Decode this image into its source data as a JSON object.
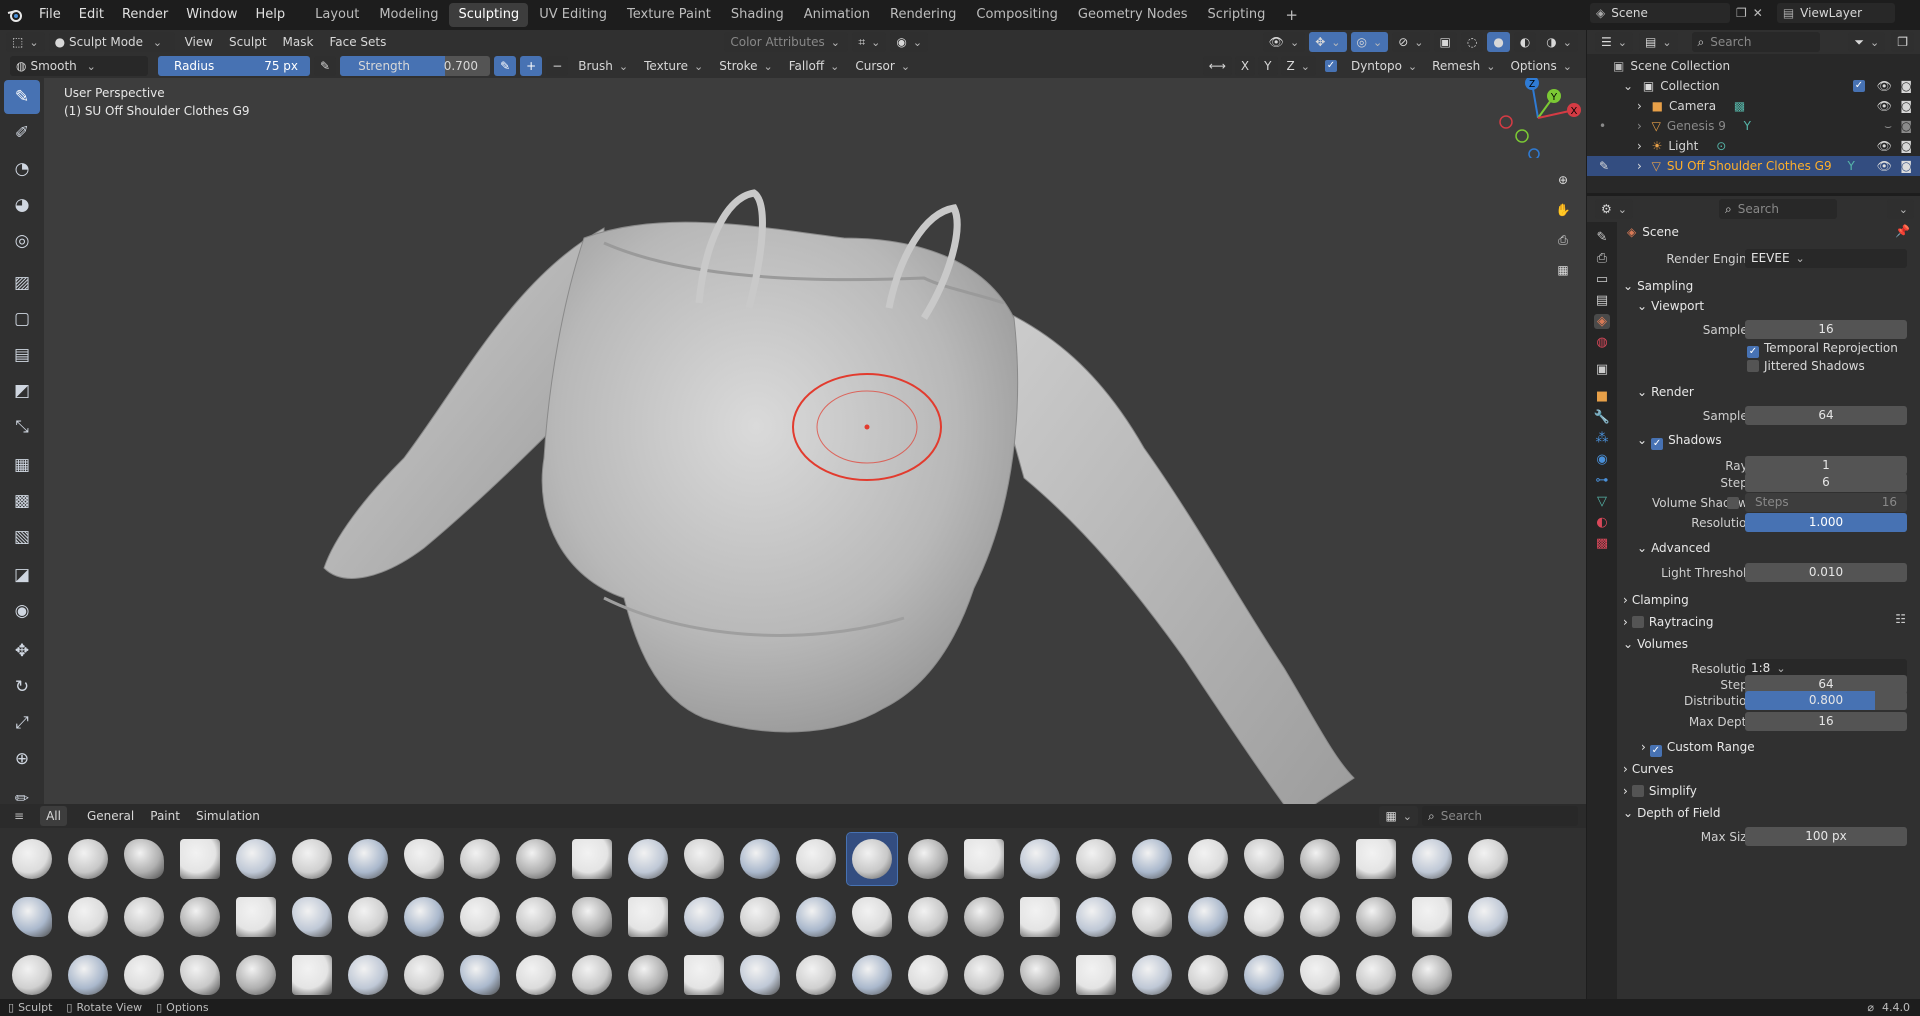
{
  "menu": {
    "items": [
      "File",
      "Edit",
      "Render",
      "Window",
      "Help"
    ]
  },
  "workspaces": {
    "tabs": [
      "Layout",
      "Modeling",
      "Sculpting",
      "UV Editing",
      "Texture Paint",
      "Shading",
      "Animation",
      "Rendering",
      "Compositing",
      "Geometry Nodes",
      "Scripting"
    ],
    "active": "Sculpting"
  },
  "scene": {
    "name": "Scene",
    "view_layer": "ViewLayer"
  },
  "header": {
    "mode": "Sculpt Mode",
    "menus": [
      "View",
      "Sculpt",
      "Mask",
      "Face Sets"
    ],
    "color_attributes": "Color Attributes"
  },
  "tool_settings": {
    "brush": "Smooth",
    "radius_label": "Radius",
    "radius_value": "75 px",
    "strength_label": "Strength",
    "strength_value": "0.700",
    "strength_level": 0.7,
    "menus": [
      "Brush",
      "Texture",
      "Stroke",
      "Falloff",
      "Cursor"
    ],
    "axes": [
      "X",
      "Y",
      "Z"
    ],
    "dyntopo": "Dyntopo",
    "remesh": "Remesh",
    "options": "Options"
  },
  "viewport": {
    "perspective": "User Perspective",
    "object_label": "(1) SU Off Shoulder Clothes G9",
    "gizmo": {
      "z": "Z",
      "y": "Y",
      "x": "X"
    }
  },
  "outliner": {
    "search_placeholder": "Search",
    "root": "Scene Collection",
    "collection": "Collection",
    "items": [
      {
        "name": "Camera",
        "type": "camera"
      },
      {
        "name": "Genesis 9",
        "type": "mesh"
      },
      {
        "name": "Light",
        "type": "light"
      },
      {
        "name": "SU Off Shoulder Clothes G9",
        "type": "mesh",
        "selected": true
      }
    ]
  },
  "properties": {
    "search_placeholder": "Search",
    "context": "Scene",
    "render_engine_label": "Render Engine",
    "render_engine": "EEVEE",
    "sampling": "Sampling",
    "viewport": "Viewport",
    "samples_label": "Samples",
    "viewport_samples": "16",
    "temporal_reprojection": "Temporal Reprojection",
    "jittered_shadows": "Jittered Shadows",
    "render": "Render",
    "render_samples": "64",
    "shadows": "Shadows",
    "rays_label": "Rays",
    "rays": "1",
    "steps_label": "Steps",
    "steps": "6",
    "volume_shadows_label": "Volume Shadows",
    "volume_steps_label": "Steps",
    "volume_steps": "16",
    "resolution_label": "Resolution",
    "resolution": "1.000",
    "advanced": "Advanced",
    "light_threshold_label": "Light Threshold",
    "light_threshold": "0.010",
    "clamping": "Clamping",
    "raytracing": "Raytracing",
    "volumes": "Volumes",
    "vol_resolution": "1:8",
    "vol_steps": "64",
    "distribution_label": "Distribution",
    "distribution": "0.800",
    "distribution_level": 0.8,
    "max_depth_label": "Max Depth",
    "max_depth": "16",
    "custom_range": "Custom Range",
    "curves": "Curves",
    "simplify": "Simplify",
    "depth_of_field": "Depth of Field",
    "max_size_label": "Max Size",
    "max_size": "100 px"
  },
  "brush_asset_shelf": {
    "tabs": [
      "All",
      "General",
      "Paint",
      "Simulation"
    ],
    "active_tab": "All",
    "search_placeholder": "Search"
  },
  "status": {
    "items": [
      "Sculpt",
      "Rotate View",
      "Options"
    ],
    "version": "4.4.0"
  },
  "colors": {
    "accent": "#4772b3",
    "brush_circle": "#e23b2e",
    "selected_text": "#ffaf29"
  }
}
